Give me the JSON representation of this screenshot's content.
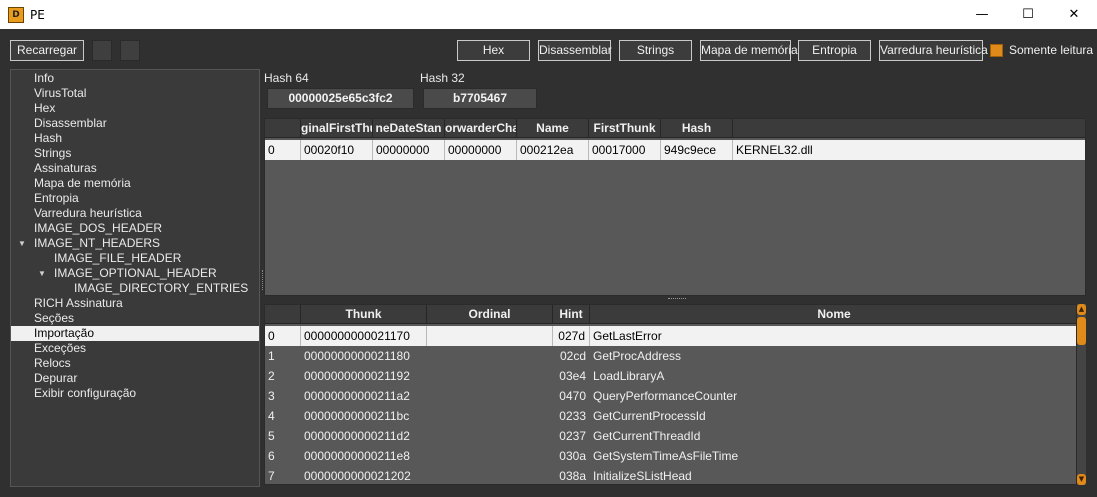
{
  "window": {
    "title": "PE",
    "app_icon_text": "D",
    "minimize": "—",
    "maximize": "☐",
    "close": "✕"
  },
  "toolbar": {
    "reload": "Recarregar",
    "tabs": [
      "Hex",
      "Disassemblar",
      "Strings",
      "Mapa de memória",
      "Entropia",
      "Varredura heurística"
    ],
    "readonly": "Somente leitura",
    "readonly_checked": true,
    "accent": "#e08a19"
  },
  "tree": {
    "items": [
      "Info",
      "VirusTotal",
      "Hex",
      "Disassemblar",
      "Hash",
      "Strings",
      "Assinaturas",
      "Mapa de memória",
      "Entropia",
      "Varredura heurística",
      "IMAGE_DOS_HEADER",
      "IMAGE_NT_HEADERS",
      "IMAGE_FILE_HEADER",
      "IMAGE_OPTIONAL_HEADER",
      "IMAGE_DIRECTORY_ENTRIES",
      "RICH Assinatura",
      "Seções",
      "Importação",
      "Exceções",
      "Relocs",
      "Depurar",
      "Exibir configuração"
    ],
    "selected": "Importação"
  },
  "hash": {
    "h64_label": "Hash 64",
    "h64_value": "00000025e65c3fc2",
    "h32_label": "Hash 32",
    "h32_value": "b7705467"
  },
  "imports_table": {
    "headers": [
      "",
      "ginalFirstThu",
      "neDateStan",
      "orwarderCha",
      "Name",
      "FirstThunk",
      "Hash",
      ""
    ],
    "rows": [
      [
        "0",
        "00020f10",
        "00000000",
        "00000000",
        "000212ea",
        "00017000",
        "949c9ece",
        "KERNEL32.dll"
      ]
    ]
  },
  "functions_table": {
    "headers": [
      "",
      "Thunk",
      "Ordinal",
      "Hint",
      "Nome"
    ],
    "rows": [
      [
        "0",
        "0000000000021170",
        "",
        "027d",
        "GetLastError"
      ],
      [
        "1",
        "0000000000021180",
        "",
        "02cd",
        "GetProcAddress"
      ],
      [
        "2",
        "0000000000021192",
        "",
        "03e4",
        "LoadLibraryA"
      ],
      [
        "3",
        "00000000000211a2",
        "",
        "0470",
        "QueryPerformanceCounter"
      ],
      [
        "4",
        "00000000000211bc",
        "",
        "0233",
        "GetCurrentProcessId"
      ],
      [
        "5",
        "00000000000211d2",
        "",
        "0237",
        "GetCurrentThreadId"
      ],
      [
        "6",
        "00000000000211e8",
        "",
        "030a",
        "GetSystemTimeAsFileTime"
      ],
      [
        "7",
        "0000000000021202",
        "",
        "038a",
        "InitializeSListHead"
      ]
    ]
  }
}
